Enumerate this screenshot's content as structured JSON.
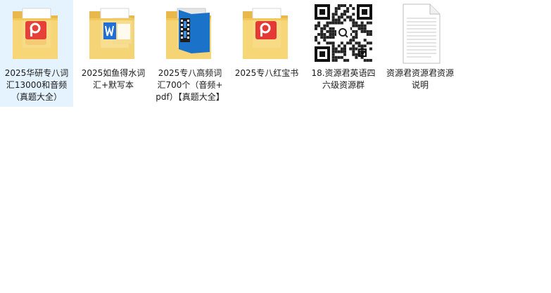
{
  "files": [
    {
      "label": "2025华研专八词汇13000和音频（真题大全）",
      "icon": "folder-pdf-icon",
      "selected": true
    },
    {
      "label": "2025如鱼得水词汇+默写本",
      "icon": "folder-doc-icon",
      "selected": false
    },
    {
      "label": "2025专八高频词汇700个（音频+pdf）【真题大全】",
      "icon": "folder-video-icon",
      "selected": false
    },
    {
      "label": "2025专八红宝书",
      "icon": "folder-pdf-icon",
      "selected": false
    },
    {
      "label": "18.资源君英语四六级资源群",
      "icon": "qr-code-icon",
      "selected": false
    },
    {
      "label": "资源君资源君资源说明",
      "icon": "text-document-icon",
      "selected": false
    }
  ],
  "colors": {
    "selection": "#e5f3ff",
    "folder_back": "#e8b84a",
    "folder_front": "#f7d87c",
    "pdf_red": "#e53935",
    "doc_blue": "#1e6fd9",
    "video_blue": "#1a73c8"
  }
}
